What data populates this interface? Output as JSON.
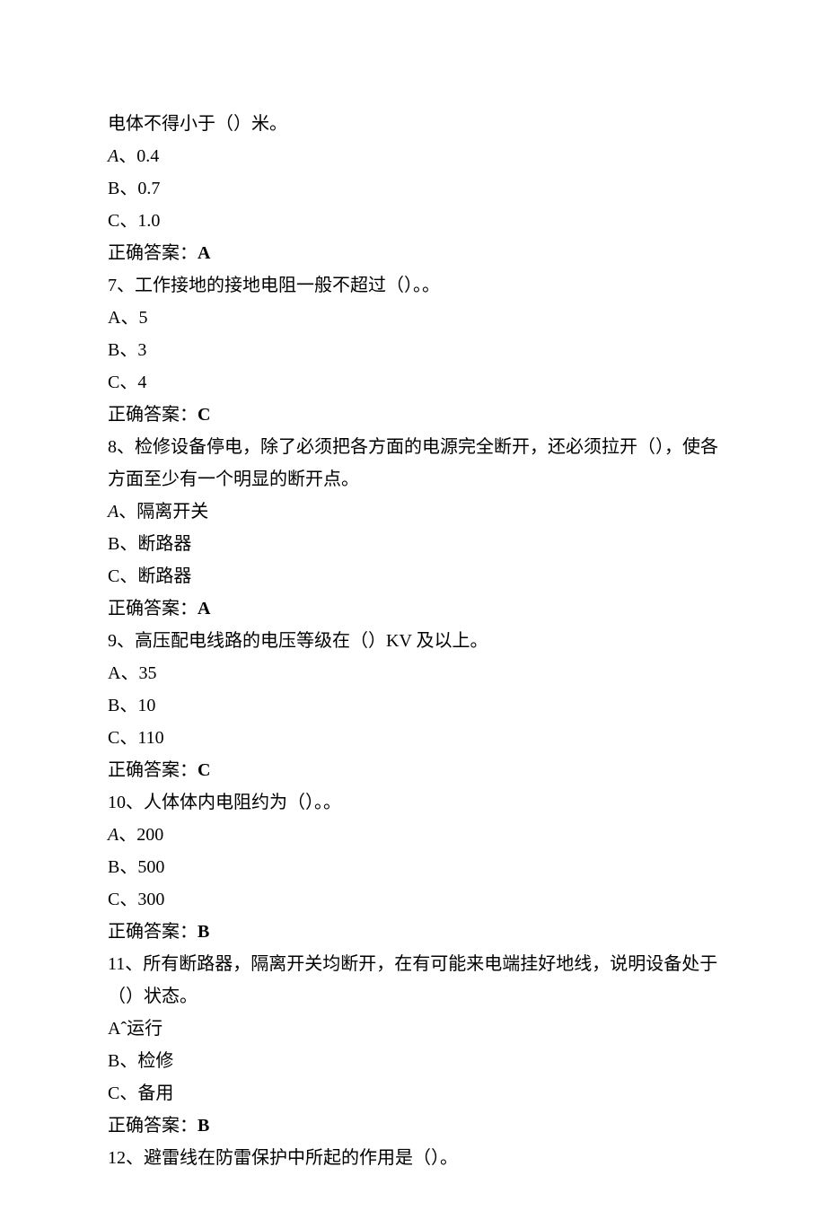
{
  "lines": [
    {
      "text": "电体不得小于（）米。"
    },
    {
      "text": "A、0.4",
      "italicA": true
    },
    {
      "text": "B、0.7"
    },
    {
      "text": "C、1.0"
    },
    {
      "answerLabel": "正确答案：",
      "answerValue": "A"
    },
    {
      "text": "7、工作接地的接地电阻一般不超过（）。。"
    },
    {
      "text": "A、5"
    },
    {
      "text": "B、3"
    },
    {
      "text": "C、4"
    },
    {
      "answerLabel": "正确答案：",
      "answerValue": "C"
    },
    {
      "text": "8、检修设备停电，除了必须把各方面的电源完全断开，还必须拉开（），使各方面至少有一个明显的断开点。"
    },
    {
      "text": "A、隔离开关",
      "italicA": true
    },
    {
      "text": "B、断路器"
    },
    {
      "text": "C、断路器"
    },
    {
      "answerLabel": "正确答案：",
      "answerValue": "A"
    },
    {
      "text": "9、高压配电线路的电压等级在（）KV 及以上。"
    },
    {
      "text": "A、35"
    },
    {
      "text": "B、10"
    },
    {
      "text": "C、110"
    },
    {
      "answerLabel": "正确答案：",
      "answerValue": "C"
    },
    {
      "text": "10、人体体内电阻约为（）。。"
    },
    {
      "text": "A、200",
      "italicA": true
    },
    {
      "text": "B、500"
    },
    {
      "text": "C、300"
    },
    {
      "answerLabel": "正确答案：",
      "answerValue": "B"
    },
    {
      "text": "11、所有断路器，隔离开关均断开，在有可能来电端挂好地线，说明设备处于（）状态。"
    },
    {
      "text": "Aˆ运行"
    },
    {
      "text": "B、检修"
    },
    {
      "text": "C、备用"
    },
    {
      "answerLabel": "正确答案：",
      "answerValue": "B"
    },
    {
      "text": "12、避雷线在防雷保护中所起的作用是（）。"
    }
  ]
}
